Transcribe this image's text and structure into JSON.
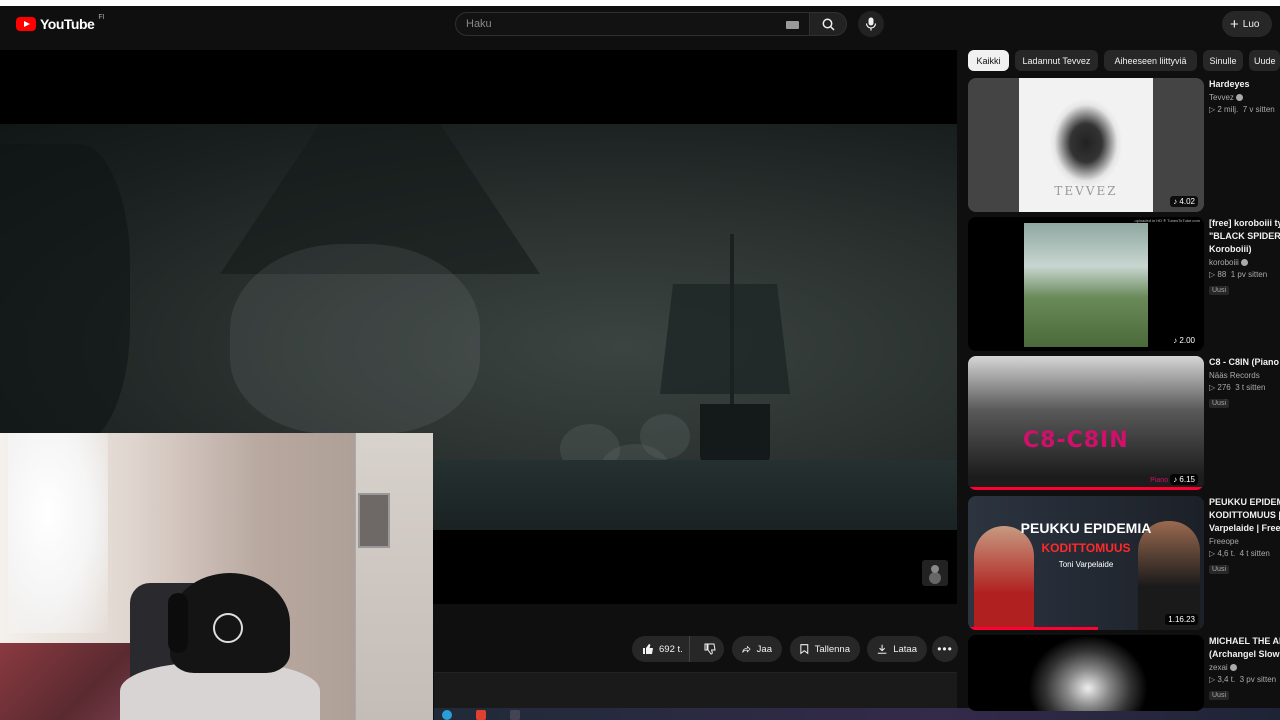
{
  "header": {
    "logo_text": "YouTube",
    "region": "FI",
    "search_placeholder": "Haku",
    "create_label": "Luo"
  },
  "actions": {
    "likes": "692 t.",
    "share": "Jaa",
    "save": "Tallenna",
    "download": "Lataa"
  },
  "chips": [
    {
      "label": "Kaikki",
      "active": true
    },
    {
      "label": "Ladannut Tevvez",
      "active": false
    },
    {
      "label": "Aiheeseen liittyviä",
      "active": false
    },
    {
      "label": "Sinulle",
      "active": false
    },
    {
      "label": "Uude",
      "active": false
    }
  ],
  "recommendations": [
    {
      "title_lines": [
        "Hardeyes"
      ],
      "channel": "Tevvez",
      "verified": true,
      "views": "2 milj.",
      "age": "7 v sitten",
      "duration": "4.02",
      "new_badge": "",
      "thumb_text": "TEVVEZ"
    },
    {
      "title_lines": [
        "[free] koroboiii ty",
        "\"BLACK SPIDER\"",
        "Koroboiii)"
      ],
      "channel": "koroboiii",
      "verified": true,
      "views": "88",
      "age": "1 pv sitten",
      "duration": "2.00",
      "new_badge": "Uusi",
      "thumb_text": "uploaded in HD ® TunesToTube.com"
    },
    {
      "title_lines": [
        "C8 - C8IN (Piano"
      ],
      "channel": "Nääs Records",
      "verified": false,
      "views": "276",
      "age": "3 t sitten",
      "duration": "6.15",
      "new_badge": "Uusi",
      "thumb_text": "C8-C8IN",
      "thumb_sub": "Piano"
    },
    {
      "title_lines": [
        "PEUKKU EPIDEMI",
        "KODITTOMUUS |",
        "Varpelaide | Free"
      ],
      "channel": "Freeope",
      "verified": false,
      "views": "4,6 t.",
      "age": "4 t sitten",
      "duration": "1.16.23",
      "new_badge": "Uusi",
      "thumb_text": "PEUKKU EPIDEMIA",
      "thumb_sub": "KODITTOMUUS",
      "thumb_sub2": "Toni Varpelaide"
    },
    {
      "title_lines": [
        "MICHAEL THE AI",
        "(Archangel Slow"
      ],
      "channel": "zexai",
      "verified": true,
      "views": "3,4 t.",
      "age": "3 pv sitten",
      "duration": "",
      "new_badge": "Uusi",
      "thumb_text": ""
    }
  ],
  "colors": {
    "background": "#0f0f0f",
    "brand_red": "#ff0000",
    "chip_bg": "#272727",
    "text_primary": "#f1f1f1",
    "text_secondary": "#aaaaaa"
  }
}
